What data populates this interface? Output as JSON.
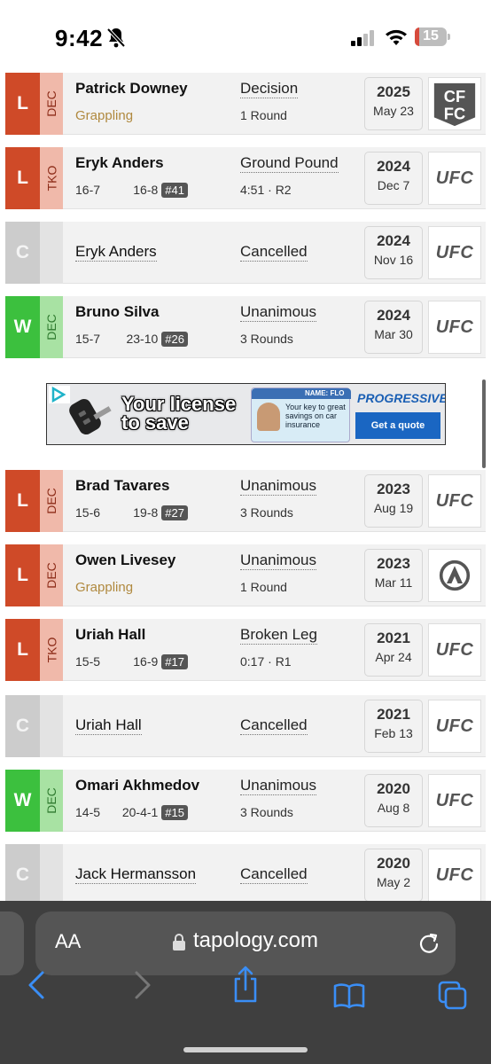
{
  "status_bar": {
    "time": "9:42",
    "battery": "15",
    "battery_level": 0.15
  },
  "fights": [
    {
      "result": "L",
      "method_short": "DEC",
      "opponent": "Patrick Downey",
      "opponent_bold": true,
      "sub": "Grappling",
      "method": "Decision",
      "detail": "1 Round",
      "year": "2025",
      "day": "May 23",
      "promotion": "CFFC"
    },
    {
      "result": "L",
      "method_short": "TKO",
      "opponent": "Eryk Anders",
      "opponent_bold": true,
      "record_opp": "16-7",
      "record_self": "16-8",
      "rank": "#41",
      "method": "Ground Pound",
      "detail": "4:51 · R2",
      "year": "2024",
      "day": "Dec 7",
      "promotion": "UFC"
    },
    {
      "result": "C",
      "method_short": "",
      "opponent": "Eryk Anders",
      "opponent_bold": false,
      "method": "Cancelled",
      "year": "2024",
      "day": "Nov 16",
      "promotion": "UFC"
    },
    {
      "result": "W",
      "method_short": "DEC",
      "opponent": "Bruno Silva",
      "opponent_bold": true,
      "record_opp": "15-7",
      "record_self": "23-10",
      "rank": "#26",
      "method": "Unanimous",
      "detail": "3 Rounds",
      "year": "2024",
      "day": "Mar 30",
      "promotion": "UFC"
    },
    {
      "result": "L",
      "method_short": "DEC",
      "opponent": "Brad Tavares",
      "opponent_bold": true,
      "record_opp": "15-6",
      "record_self": "19-8",
      "rank": "#27",
      "method": "Unanimous",
      "detail": "3 Rounds",
      "year": "2023",
      "day": "Aug 19",
      "promotion": "UFC"
    },
    {
      "result": "L",
      "method_short": "DEC",
      "opponent": "Owen Livesey",
      "opponent_bold": true,
      "sub": "Grappling",
      "method": "Unanimous",
      "detail": "1 Round",
      "year": "2023",
      "day": "Mar 11",
      "promotion": "ADCC"
    },
    {
      "result": "L",
      "method_short": "TKO",
      "opponent": "Uriah Hall",
      "opponent_bold": true,
      "record_opp": "15-5",
      "record_self": "16-9",
      "rank": "#17",
      "method": "Broken Leg",
      "detail": "0:17 · R1",
      "year": "2021",
      "day": "Apr 24",
      "promotion": "UFC"
    },
    {
      "result": "C",
      "method_short": "",
      "opponent": "Uriah Hall",
      "opponent_bold": false,
      "method": "Cancelled",
      "year": "2021",
      "day": "Feb 13",
      "promotion": "UFC"
    },
    {
      "result": "W",
      "method_short": "DEC",
      "opponent": "Omari Akhmedov",
      "opponent_bold": true,
      "record_opp": "14-5",
      "record_self": "20-4-1",
      "rank": "#15",
      "method": "Unanimous",
      "detail": "3 Rounds",
      "year": "2020",
      "day": "Aug 8",
      "promotion": "UFC"
    },
    {
      "result": "C",
      "method_short": "",
      "opponent": "Jack Hermansson",
      "opponent_bold": false,
      "method": "Cancelled",
      "year": "2020",
      "day": "May 2",
      "promotion": "UFC"
    }
  ],
  "ad": {
    "headline": "Your license to save",
    "card_label": "NAME: FLO",
    "card_text": "Your key to great savings on car insurance",
    "brand": "PROGRESSIVE",
    "cta": "Get a quote"
  },
  "browser": {
    "aa_label": "AA",
    "url": "tapology.com"
  },
  "colors": {
    "win": "#3cc03e",
    "loss": "#cf4a28",
    "cancelled": "#cccccc",
    "safari_bar": "#3f3f3f",
    "ios_blue": "#3a8ef6"
  }
}
